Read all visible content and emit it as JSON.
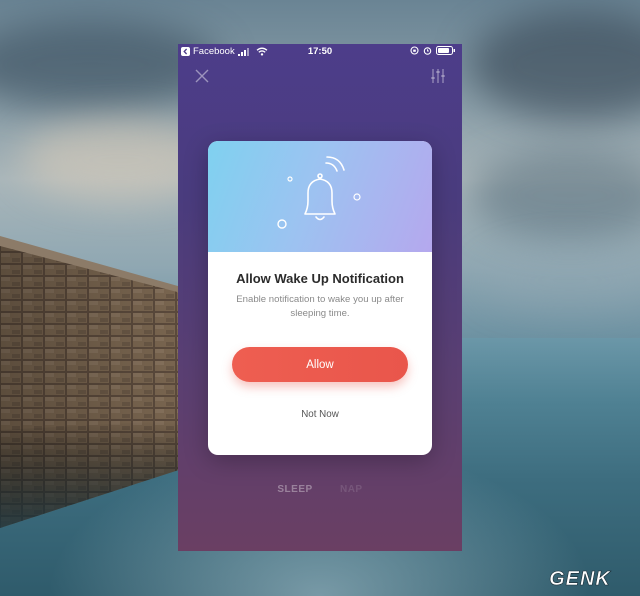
{
  "status_bar": {
    "back_app": "Facebook",
    "time": "17:50"
  },
  "dialog": {
    "title": "Allow Wake Up Notification",
    "description": "Enable notification to wake you up after sleeping time.",
    "allow_label": "Allow",
    "not_now_label": "Not Now"
  },
  "tabs": [
    {
      "label": "SLEEP"
    },
    {
      "label": "NAP"
    }
  ],
  "watermark": {
    "text": "GENK"
  },
  "icons": {
    "close": "close-icon",
    "settings": "sliders-icon",
    "hero": "bell-icon"
  },
  "colors": {
    "accent": "#ec5b4f",
    "phone_bg_top": "#4d3d8a",
    "phone_bg_bottom": "#6a3f63",
    "hero_gradient_start": "#7fd1f0",
    "hero_gradient_end": "#b5a8ee"
  }
}
